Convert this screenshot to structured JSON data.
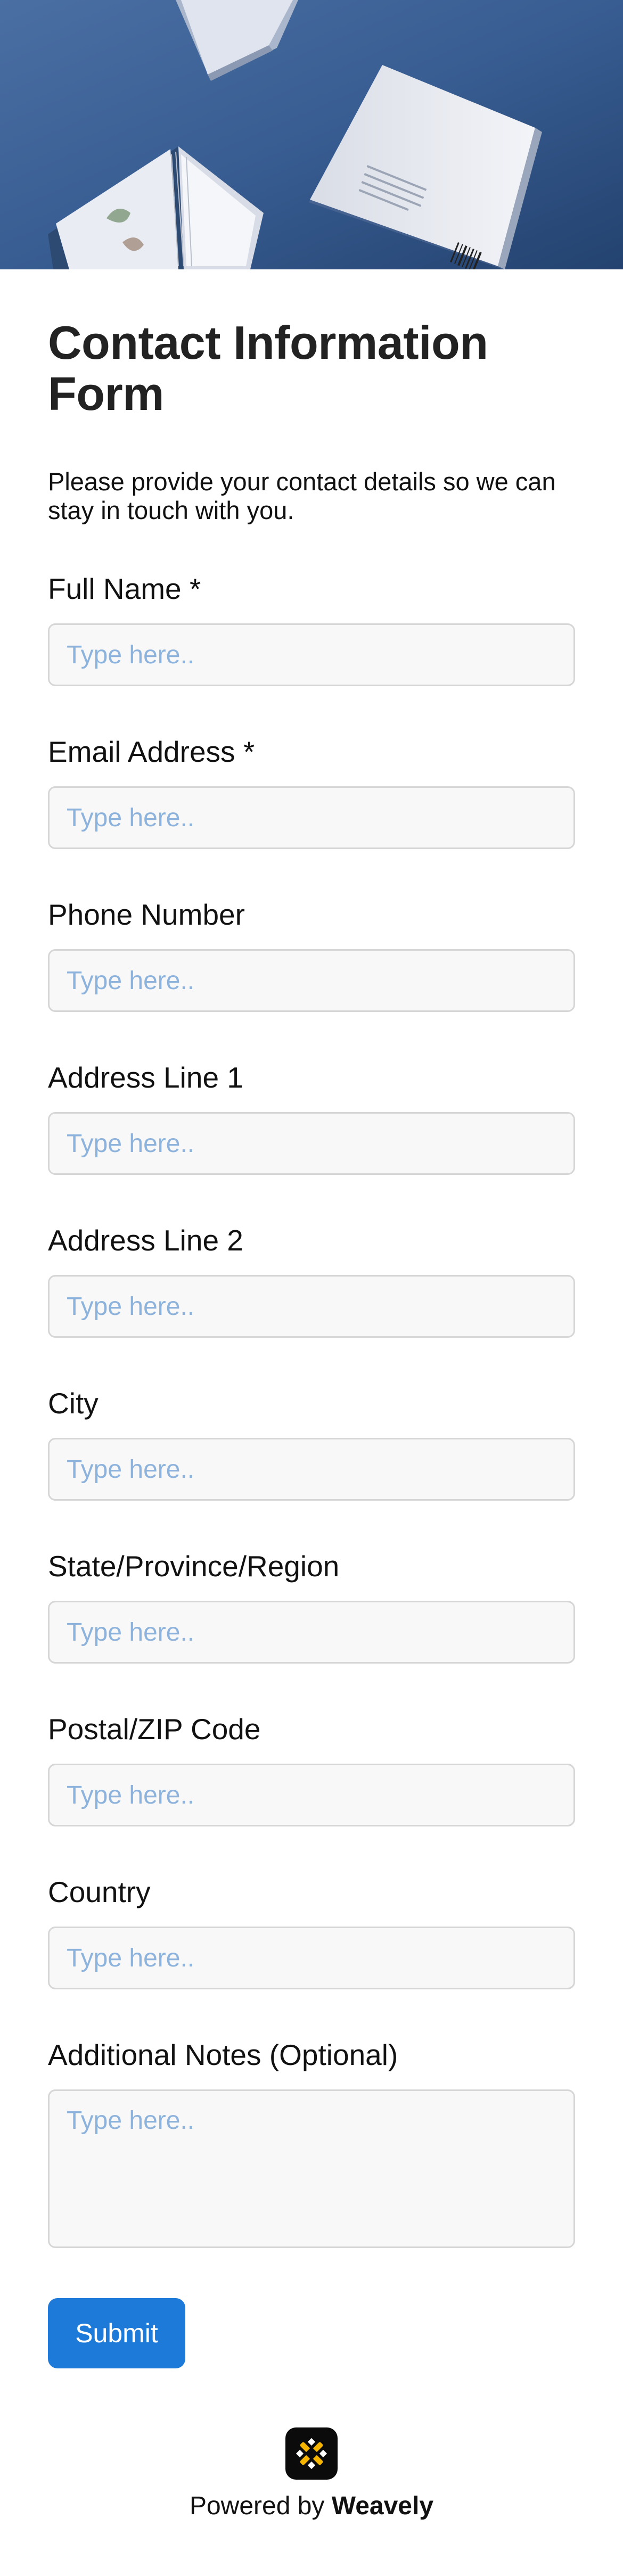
{
  "form": {
    "title": "Contact Information Form",
    "description": "Please provide your contact details so we can stay in touch with you.",
    "fields": [
      {
        "label": "Full Name *",
        "placeholder": "Type here..",
        "value": ""
      },
      {
        "label": "Email Address *",
        "placeholder": "Type here..",
        "value": ""
      },
      {
        "label": "Phone Number",
        "placeholder": "Type here..",
        "value": ""
      },
      {
        "label": "Address Line 1",
        "placeholder": "Type here..",
        "value": ""
      },
      {
        "label": "Address Line 2",
        "placeholder": "Type here..",
        "value": ""
      },
      {
        "label": "City",
        "placeholder": "Type here..",
        "value": ""
      },
      {
        "label": "State/Province/Region",
        "placeholder": "Type here..",
        "value": ""
      },
      {
        "label": "Postal/ZIP Code",
        "placeholder": "Type here..",
        "value": ""
      },
      {
        "label": "Country",
        "placeholder": "Type here..",
        "value": ""
      },
      {
        "label": "Additional Notes (Optional)",
        "placeholder": "Type here..",
        "value": ""
      }
    ],
    "submit_label": "Submit"
  },
  "footer": {
    "powered_prefix": "Powered by",
    "brand": "Weavely",
    "logo_icon": "weavely-logo-icon"
  },
  "colors": {
    "accent": "#1e7ad8",
    "placeholder": "#8db3dc",
    "hero_background": "#355a8e",
    "input_background": "#f8f8f8"
  }
}
